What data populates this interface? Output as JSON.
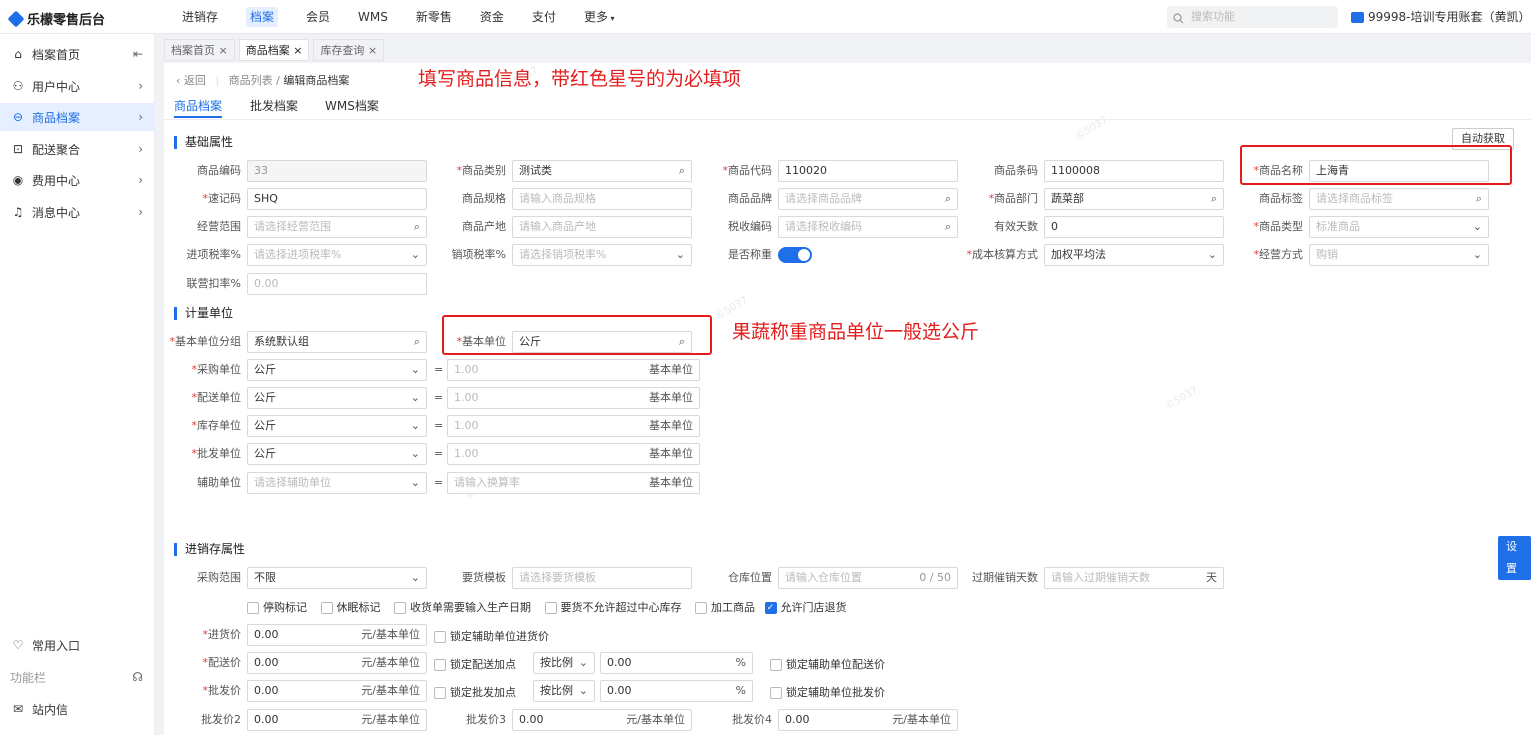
{
  "app": {
    "title": "乐檬零售后台"
  },
  "nav": [
    "进销存",
    "档案",
    "会员",
    "WMS",
    "新零售",
    "资金",
    "支付",
    "更多"
  ],
  "search": {
    "placeholder": "搜索功能"
  },
  "account": {
    "label": "99998-培训专用账套（黄凯）-..."
  },
  "sidebar": {
    "items": [
      "档案首页",
      "用户中心",
      "商品档案",
      "配送聚合",
      "费用中心",
      "消息中心"
    ],
    "bottom": [
      "常用入口",
      "功能栏",
      "站内信"
    ]
  },
  "page_tabs": [
    "档案首页",
    "商品档案",
    "库存查询"
  ],
  "breadcrumb": {
    "back": "返回",
    "parent": "商品列表",
    "current": "编辑商品档案"
  },
  "sub_tabs": [
    "商品档案",
    "批发档案",
    "WMS档案"
  ],
  "annotations": {
    "top": "填写商品信息，带红色星号的为必填项",
    "unit": "果蔬称重商品单位一般选公斤"
  },
  "buttons": {
    "auto_fetch": "自动获取",
    "settings": "设置"
  },
  "sections": {
    "basic": "基础属性",
    "unit": "计量单位",
    "inventory": "进销存属性"
  },
  "basic": {
    "code_label": "商品编码",
    "code_value": "33",
    "category_label": "商品类别",
    "category_value": "测试类",
    "item_code_label": "商品代码",
    "item_code_value": "110020",
    "barcode_label": "商品条码",
    "barcode_value": "1100008",
    "name_label": "商品名称",
    "name_value": "上海青",
    "shortcode_label": "速记码",
    "shortcode_value": "SHQ",
    "spec_label": "商品规格",
    "spec_ph": "请输入商品规格",
    "brand_label": "商品品牌",
    "brand_ph": "请选择商品品牌",
    "dept_label": "商品部门",
    "dept_value": "蔬菜部",
    "tag_label": "商品标签",
    "tag_ph": "请选择商品标签",
    "scope_label": "经营范围",
    "scope_ph": "请选择经营范围",
    "origin_label": "商品产地",
    "origin_ph": "请输入商品产地",
    "tax_label": "税收编码",
    "tax_ph": "请选择税收编码",
    "valid_label": "有效天数",
    "valid_value": "0",
    "type_label": "商品类型",
    "type_value": "标准商品",
    "in_tax_label": "进项税率%",
    "in_tax_ph": "请选择进项税率%",
    "out_tax_label": "销项税率%",
    "out_tax_ph": "请选择销项税率%",
    "weigh_label": "是否称重",
    "cost_label": "成本核算方式",
    "cost_value": "加权平均法",
    "mode_label": "经营方式",
    "mode_value": "购销",
    "joint_label": "联营扣率%",
    "joint_value": "0.00"
  },
  "unit": {
    "group_label": "基本单位分组",
    "group_value": "系统默认组",
    "base_label": "基本单位",
    "base_value": "公斤",
    "rows": [
      {
        "label": "采购单位",
        "value": "公斤",
        "rate": "1.00",
        "ph": false
      },
      {
        "label": "配送单位",
        "value": "公斤",
        "rate": "1.00",
        "ph": false
      },
      {
        "label": "库存单位",
        "value": "公斤",
        "rate": "1.00",
        "ph": false
      },
      {
        "label": "批发单位",
        "value": "公斤",
        "rate": "1.00",
        "ph": false
      },
      {
        "label": "辅助单位",
        "value": "请选择辅助单位",
        "rate": "请输入换算率",
        "ph": true
      }
    ],
    "suffix": "基本单位",
    "eq": "="
  },
  "inventory": {
    "range_label": "采购范围",
    "range_value": "不限",
    "template_label": "要货模板",
    "template_ph": "请选择要货模板",
    "loc_label": "仓库位置",
    "loc_ph": "请输入仓库位置",
    "loc_count": "0 / 50",
    "promo_label": "过期催销天数",
    "promo_ph": "请输入过期催销天数",
    "promo_unit": "天",
    "checks": [
      {
        "label": "停购标记",
        "on": false
      },
      {
        "label": "休眠标记",
        "on": false
      },
      {
        "label": "收货单需要输入生产日期",
        "on": false
      },
      {
        "label": "要货不允许超过中心库存",
        "on": false
      },
      {
        "label": "加工商品",
        "on": false
      },
      {
        "label": "允许门店退货",
        "on": true
      }
    ],
    "in_price_label": "进货价",
    "in_price_value": "0.00",
    "price_unit": "元/基本单位",
    "lock_in_aux": "锁定辅助单位进货价",
    "dist_price_label": "配送价",
    "dist_price_value": "0.00",
    "lock_dist_add": "锁定配送加点",
    "ratio": "按比例",
    "dist_pct": "0.00",
    "pct": "%",
    "lock_dist_aux": "锁定辅助单位配送价",
    "whole_price_label": "批发价",
    "whole_price_value": "0.00",
    "lock_whole_add": "锁定批发加点",
    "whole_pct": "0.00",
    "lock_whole_aux": "锁定辅助单位批发价",
    "wp2_label": "批发价2",
    "wp2_value": "0.00",
    "wp3_label": "批发价3",
    "wp3_value": "0.00",
    "wp4_label": "批发价4",
    "wp4_value": "0.00"
  }
}
